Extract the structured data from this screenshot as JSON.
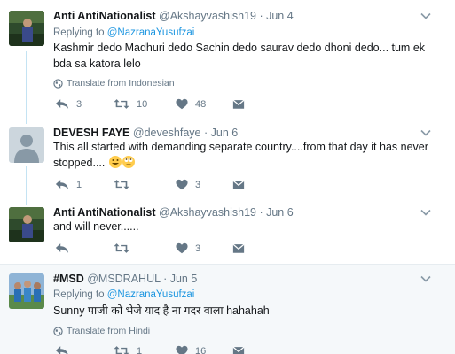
{
  "tweets": [
    {
      "name": "Anti AntiNationalist",
      "handle": "@Akshayvashish19",
      "dot": "·",
      "time": "Jun 4",
      "replying_prefix": "Replying to",
      "replying_to": "@NazranaYusufzai",
      "text": "Kashmir dedo Madhuri dedo Sachin dedo saurav dedo dhoni dedo... tum ek bda sa katora lelo",
      "translate": "Translate from Indonesian",
      "replies": "3",
      "retweets": "10",
      "likes": "48"
    },
    {
      "name": "DEVESH FAYE",
      "handle": "@deveshfaye",
      "dot": "·",
      "time": "Jun 6",
      "text": "This all started with demanding separate country....from that day it has never stopped....",
      "replies": "1",
      "retweets": "",
      "likes": "3"
    },
    {
      "name": "Anti AntiNationalist",
      "handle": "@Akshayvashish19",
      "dot": "·",
      "time": "Jun 6",
      "text": "and will never......",
      "replies": "",
      "retweets": "",
      "likes": "3"
    },
    {
      "name": "#MSD",
      "handle": "@MSDRAHUL",
      "dot": "·",
      "time": "Jun 5",
      "replying_prefix": "Replying to",
      "replying_to": "@NazranaYusufzai",
      "text": "Sunny पाजी को भेजे याद है ना गदर वाला hahahah",
      "translate": "Translate from Hindi",
      "replies": "",
      "retweets": "1",
      "likes": "16"
    }
  ],
  "icons": {
    "reply": "reply-icon",
    "retweet": "retweet-icon",
    "like": "heart-icon",
    "message": "envelope-icon",
    "globe": "globe-icon",
    "caret": "chevron-down-icon"
  },
  "colors": {
    "link": "#1b95e0",
    "muted": "#657786",
    "thread_line": "#c4e3f3",
    "highlight_bg": "#f5f8fa"
  }
}
